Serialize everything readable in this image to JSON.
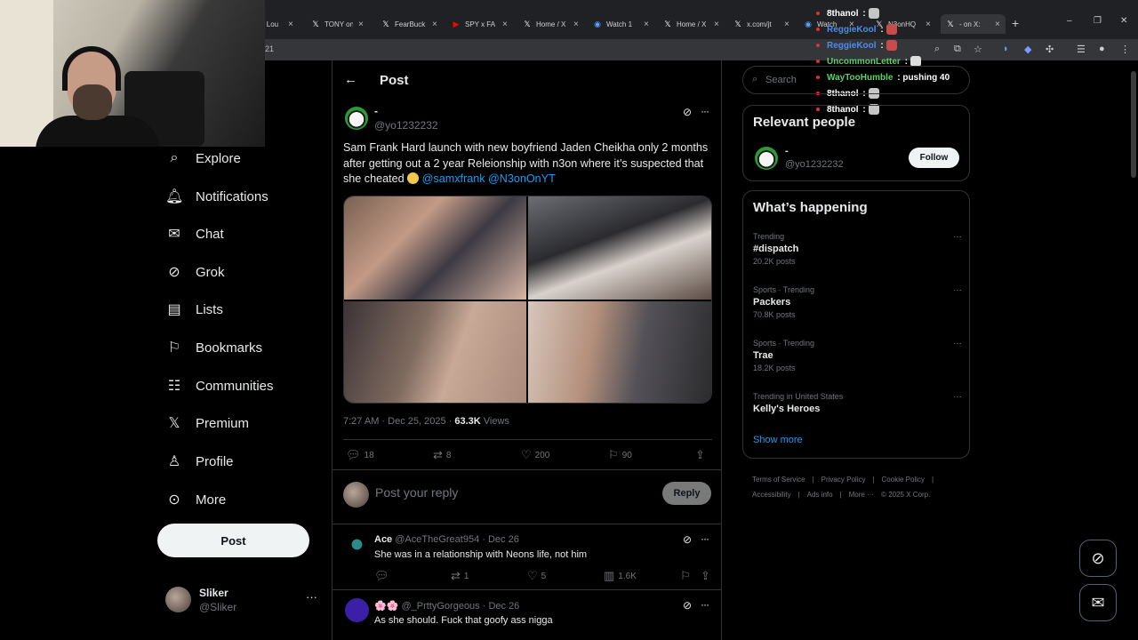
{
  "browser": {
    "tabs": [
      {
        "title": "lly Lou",
        "icon": "x-logo"
      },
      {
        "title": "TONY on",
        "icon": "x-logo"
      },
      {
        "title": "FearBuck",
        "icon": "x-logo"
      },
      {
        "title": "SPY x FA",
        "icon": "youtube-icon"
      },
      {
        "title": "Home / X",
        "icon": "x-logo"
      },
      {
        "title": "Watch 1",
        "icon": "stream-icon"
      },
      {
        "title": "Home / X",
        "icon": "x-logo"
      },
      {
        "title": "x.com/jt",
        "icon": "x-logo"
      },
      {
        "title": "Watch",
        "icon": "stream-icon"
      },
      {
        "title": "N3onHQ",
        "icon": "x-logo"
      },
      {
        "title": "- on X:",
        "icon": "x-logo"
      }
    ],
    "address_fragment": "21"
  },
  "chat": [
    {
      "user": "8thanol",
      "color": "#ffffff",
      "msg": "",
      "emote": true
    },
    {
      "user": "ReggieKool",
      "color": "#4b8cf0",
      "msg": "",
      "emote": true
    },
    {
      "user": "ReggieKool",
      "color": "#4b8cf0",
      "msg": "",
      "emote": true
    },
    {
      "user": "UncommonLetter",
      "color": "#58d36b",
      "msg": "",
      "emote": true
    },
    {
      "user": "WayTooHumble",
      "color": "#58d36b",
      "msg": "pushing 40",
      "emote": false
    },
    {
      "user": "8thanol",
      "color": "#ffffff",
      "msg": "",
      "emote": true
    },
    {
      "user": "8thanol",
      "color": "#ffffff",
      "msg": "",
      "emote": true
    }
  ],
  "nav": [
    {
      "label": "Explore",
      "icon": "search-icon"
    },
    {
      "label": "Notifications",
      "icon": "bell-icon"
    },
    {
      "label": "Chat",
      "icon": "mail-icon"
    },
    {
      "label": "Grok",
      "icon": "grok-icon"
    },
    {
      "label": "Lists",
      "icon": "list-icon"
    },
    {
      "label": "Bookmarks",
      "icon": "bookmark-icon"
    },
    {
      "label": "Communities",
      "icon": "communities-icon"
    },
    {
      "label": "Premium",
      "icon": "x-logo"
    },
    {
      "label": "Profile",
      "icon": "person-icon"
    },
    {
      "label": "More",
      "icon": "more-circle-icon"
    }
  ],
  "post_button": "Post",
  "account": {
    "name": "Sliker",
    "handle": "@Sliker"
  },
  "main": {
    "title": "Post",
    "author": {
      "name": "-",
      "handle": "@yo1232232"
    },
    "text": "Sam Frank Hard launch with new boyfriend Jaden Cheikha only 2 months after getting out a 2 year Releionship with n3on where it’s suspected that she cheated",
    "mentions": [
      "@samxfrank",
      "@N3onOnYT"
    ],
    "time": "7:27 AM · Dec 25, 2025 · ",
    "views_count": "63.3K",
    "views_label": "Views",
    "stats": {
      "replies": "18",
      "reposts": "8",
      "likes": "200",
      "bookmarks": "90"
    },
    "reply_placeholder": "Post your reply",
    "reply_button": "Reply"
  },
  "comments": [
    {
      "name": "Ace",
      "handle": "@AceTheGreat954 · Dec 26",
      "text": "She was in a relationship with Neons life, not him",
      "reposts": "1",
      "likes": "5",
      "views": "1.6K"
    },
    {
      "name": "🌸🌸",
      "handle": "@_PrttyGorgeous · Dec 26",
      "text": "As she should. Fuck that goofy ass nigga"
    }
  ],
  "right": {
    "search_placeholder": "Search",
    "relevant_title": "Relevant people",
    "relevant_person": {
      "name": "-",
      "handle": "@yo1232232",
      "button": "Follow"
    },
    "happening_title": "What’s happening",
    "trends": [
      {
        "context": "Trending",
        "name": "#dispatch",
        "posts": "20.2K posts"
      },
      {
        "context": "Sports · Trending",
        "name": "Packers",
        "posts": "70.8K posts"
      },
      {
        "context": "Sports · Trending",
        "name": "Trae",
        "posts": "18.2K posts"
      },
      {
        "context": "Trending in United States",
        "name": "Kelly's Heroes",
        "posts": ""
      }
    ],
    "show_more": "Show more",
    "footer": [
      "Terms of Service",
      "|",
      "Privacy Policy",
      "|",
      "Cookie Policy",
      "|",
      "Accessibility",
      "|",
      "Ads info",
      "|",
      "More ···",
      "© 2025 X Corp."
    ]
  }
}
